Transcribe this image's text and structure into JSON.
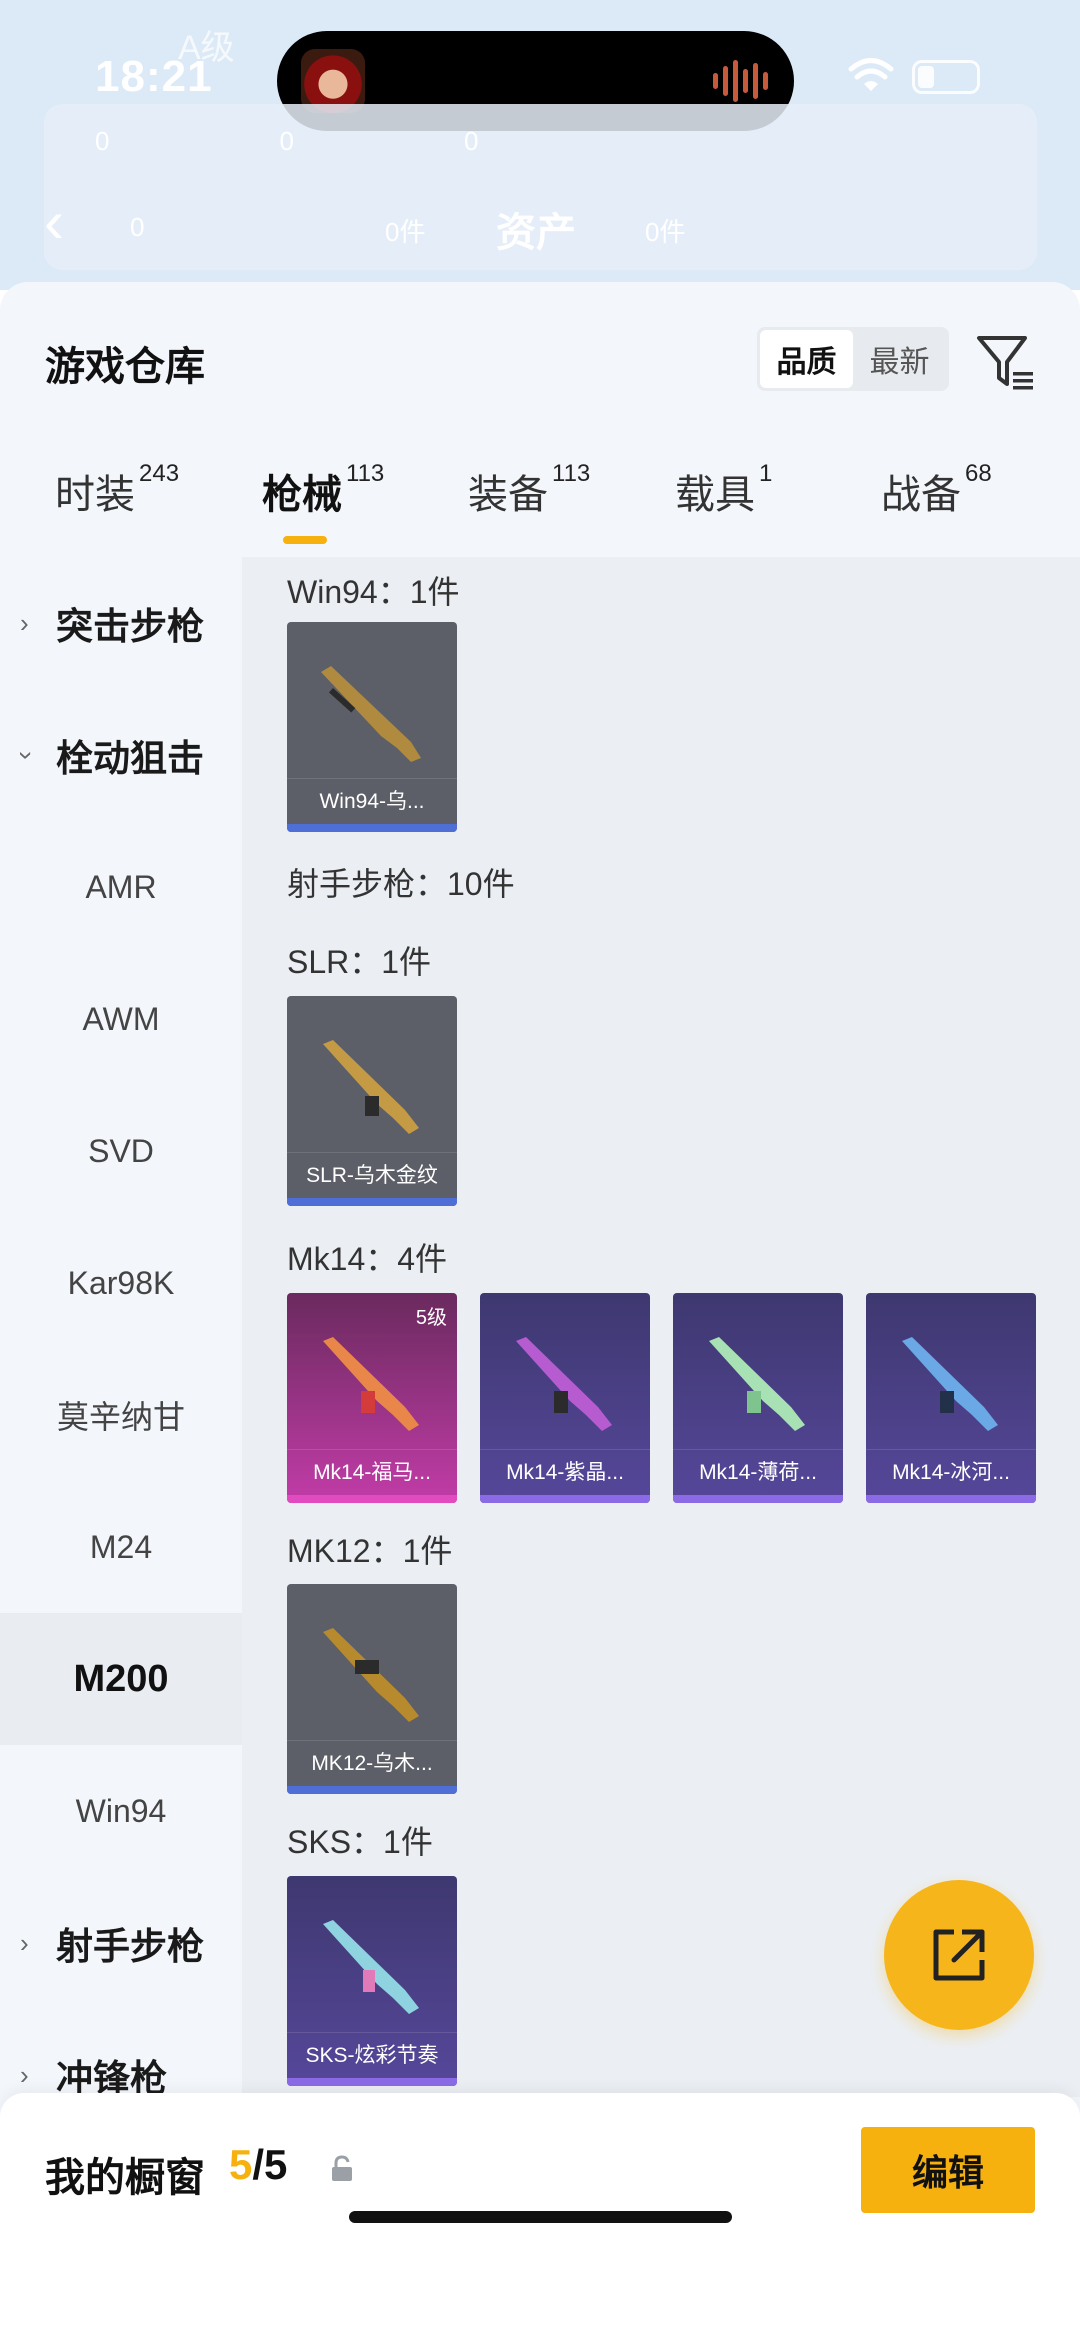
{
  "status": {
    "time": "18:21",
    "faded_label": "A级"
  },
  "header": {
    "title": "资产",
    "row1": [
      "0",
      "0",
      "0"
    ],
    "sub_left": "0",
    "sub_mid": "0件",
    "sub_right": "0件"
  },
  "panel": {
    "title": "游戏仓库",
    "sort": {
      "quality": "品质",
      "latest": "最新"
    }
  },
  "tabs": [
    {
      "label": "时装",
      "count": "243"
    },
    {
      "label": "枪械",
      "count": "113"
    },
    {
      "label": "装备",
      "count": "113"
    },
    {
      "label": "载具",
      "count": "1"
    },
    {
      "label": "战备",
      "count": "68"
    }
  ],
  "sidebar": {
    "assault": "突击步枪",
    "bolt": "栓动狙击",
    "subs": [
      "AMR",
      "AWM",
      "SVD",
      "Kar98K",
      "莫辛纳甘",
      "M24",
      "M200",
      "Win94"
    ],
    "dmr": "射手步枪",
    "smg": "冲锋枪"
  },
  "content": {
    "win94_title": "Win94：1件",
    "win94_card": "Win94-乌...",
    "dmr_title": "射手步枪：10件",
    "slr_title": "SLR：1件",
    "slr_card": "SLR-乌木金纹",
    "mk14_title": "Mk14：4件",
    "mk14_cards": [
      "Mk14-福马...",
      "Mk14-紫晶...",
      "Mk14-薄荷...",
      "Mk14-冰河..."
    ],
    "mk14_level": "5级",
    "mk12_title": "MK12：1件",
    "mk12_card": "MK12-乌木...",
    "sks_title": "SKS：1件",
    "sks_card": "SKS-炫彩节奏"
  },
  "bottom": {
    "showcase_label": "我的橱窗",
    "current": "5",
    "total": "/5",
    "edit": "编辑"
  },
  "colors": {
    "accent": "#f6b10f",
    "panel_bg": "#f3f7fc",
    "content_bg": "#ebeff4"
  }
}
